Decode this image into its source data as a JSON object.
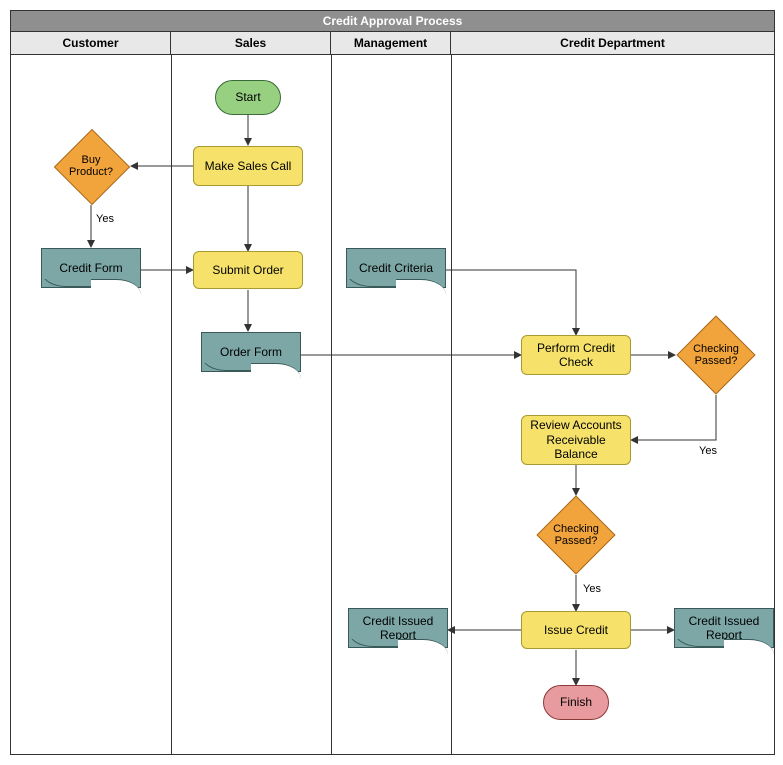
{
  "title": "Credit Approval Process",
  "lanes": {
    "customer": "Customer",
    "sales": "Sales",
    "management": "Management",
    "credit": "Credit Department"
  },
  "nodes": {
    "start": "Start",
    "finish": "Finish",
    "make_sales_call": "Make Sales Call",
    "submit_order": "Submit Order",
    "perform_credit_check": "Perform Credit Check",
    "review_ar_balance": "Review Accounts Receivable Balance",
    "issue_credit": "Issue Credit",
    "buy_product": "Buy Product?",
    "checking_passed_1": "Checking Passed?",
    "checking_passed_2": "Checking Passed?",
    "credit_form": "Credit Form",
    "order_form": "Order Form",
    "credit_criteria": "Credit Criteria",
    "credit_report_1": "Credit Issued Report",
    "credit_report_2": "Credit Issued Report"
  },
  "edge_labels": {
    "yes1": "Yes",
    "yes2": "Yes",
    "yes3": "Yes"
  },
  "chart_data": {
    "type": "flowchart",
    "title": "Credit Approval Process",
    "swimlanes": [
      "Customer",
      "Sales",
      "Management",
      "Credit Department"
    ],
    "nodes": [
      {
        "id": "start",
        "type": "terminator",
        "lane": "Sales",
        "label": "Start"
      },
      {
        "id": "make_sales_call",
        "type": "process",
        "lane": "Sales",
        "label": "Make Sales Call"
      },
      {
        "id": "buy_product",
        "type": "decision",
        "lane": "Customer",
        "label": "Buy Product?"
      },
      {
        "id": "credit_form",
        "type": "document",
        "lane": "Customer",
        "label": "Credit Form"
      },
      {
        "id": "submit_order",
        "type": "process",
        "lane": "Sales",
        "label": "Submit Order"
      },
      {
        "id": "order_form",
        "type": "document",
        "lane": "Sales",
        "label": "Order Form"
      },
      {
        "id": "credit_criteria",
        "type": "document",
        "lane": "Management",
        "label": "Credit Criteria"
      },
      {
        "id": "perform_credit_check",
        "type": "process",
        "lane": "Credit Department",
        "label": "Perform Credit Check"
      },
      {
        "id": "checking_passed_1",
        "type": "decision",
        "lane": "Credit Department",
        "label": "Checking Passed?"
      },
      {
        "id": "review_ar_balance",
        "type": "process",
        "lane": "Credit Department",
        "label": "Review Accounts Receivable Balance"
      },
      {
        "id": "checking_passed_2",
        "type": "decision",
        "lane": "Credit Department",
        "label": "Checking Passed?"
      },
      {
        "id": "issue_credit",
        "type": "process",
        "lane": "Credit Department",
        "label": "Issue Credit"
      },
      {
        "id": "credit_report_1",
        "type": "document",
        "lane": "Credit Department",
        "label": "Credit Issued Report"
      },
      {
        "id": "credit_report_2",
        "type": "document",
        "lane": "Credit Department",
        "label": "Credit Issued Report"
      },
      {
        "id": "finish",
        "type": "terminator",
        "lane": "Credit Department",
        "label": "Finish"
      }
    ],
    "edges": [
      {
        "from": "start",
        "to": "make_sales_call"
      },
      {
        "from": "make_sales_call",
        "to": "buy_product"
      },
      {
        "from": "make_sales_call",
        "to": "submit_order"
      },
      {
        "from": "buy_product",
        "to": "credit_form",
        "label": "Yes"
      },
      {
        "from": "credit_form",
        "to": "submit_order"
      },
      {
        "from": "submit_order",
        "to": "order_form"
      },
      {
        "from": "order_form",
        "to": "perform_credit_check"
      },
      {
        "from": "credit_criteria",
        "to": "perform_credit_check"
      },
      {
        "from": "perform_credit_check",
        "to": "checking_passed_1"
      },
      {
        "from": "checking_passed_1",
        "to": "review_ar_balance",
        "label": "Yes"
      },
      {
        "from": "review_ar_balance",
        "to": "checking_passed_2"
      },
      {
        "from": "checking_passed_2",
        "to": "issue_credit",
        "label": "Yes"
      },
      {
        "from": "issue_credit",
        "to": "credit_report_1"
      },
      {
        "from": "issue_credit",
        "to": "credit_report_2"
      },
      {
        "from": "issue_credit",
        "to": "finish"
      }
    ]
  }
}
